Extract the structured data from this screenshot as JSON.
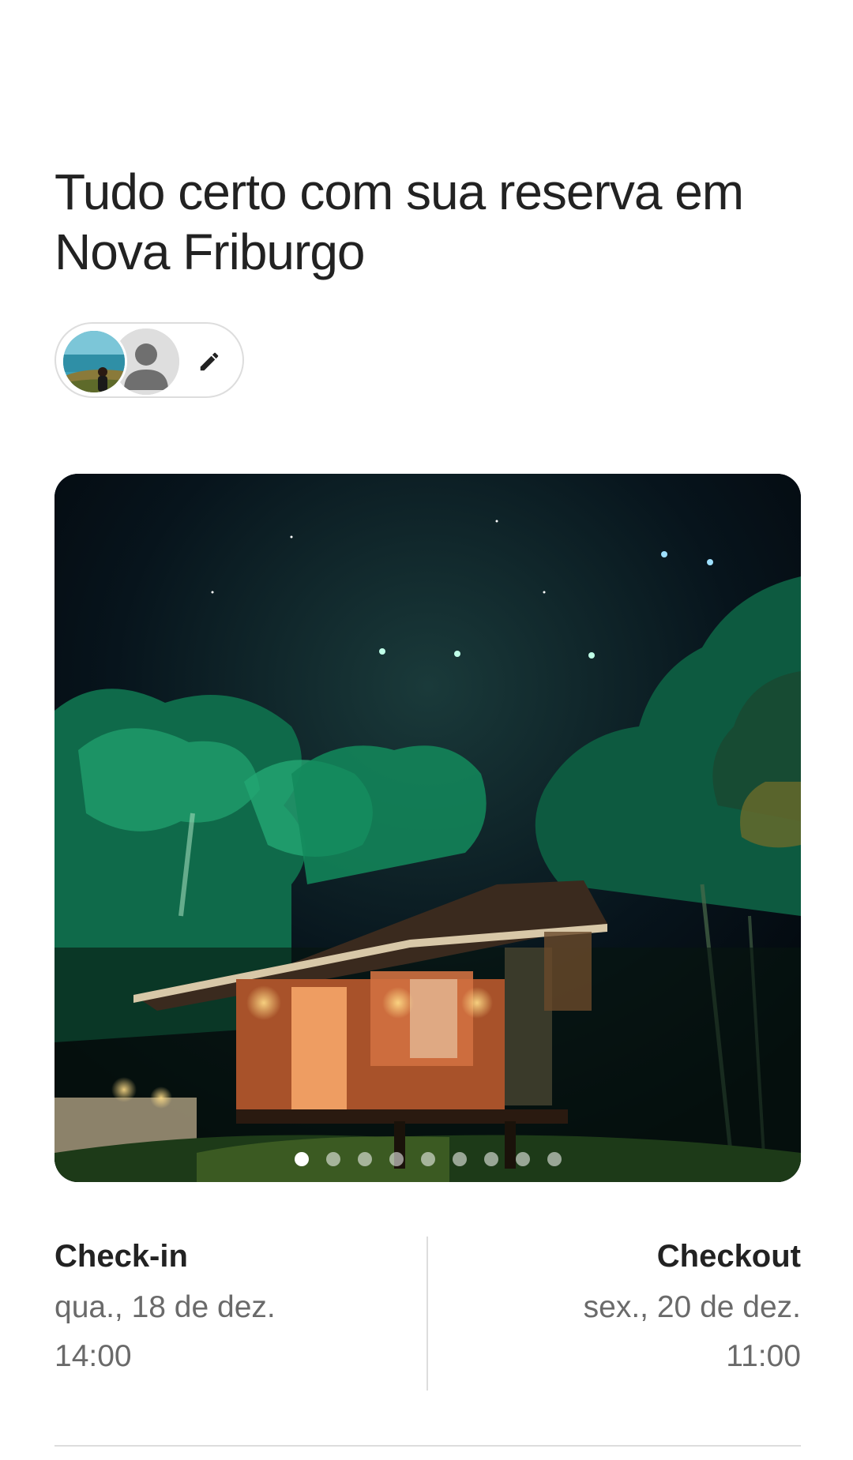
{
  "header": {
    "title": "Tudo certo com sua reserva em Nova Friburgo"
  },
  "guests": {
    "avatars": [
      {
        "name_icon": "guest-photo-avatar"
      },
      {
        "name_icon": "person-placeholder-icon"
      }
    ],
    "edit_icon": "pencil-icon"
  },
  "gallery": {
    "photo_count": 9,
    "active_index": 0
  },
  "stay": {
    "checkin": {
      "label": "Check-in",
      "date": "qua., 18 de dez.",
      "time": "14:00"
    },
    "checkout": {
      "label": "Checkout",
      "date": "sex., 20 de dez.",
      "time": "11:00"
    }
  },
  "colors": {
    "text_primary": "#222222",
    "text_secondary": "#6a6a6a",
    "border": "#dddddd"
  }
}
